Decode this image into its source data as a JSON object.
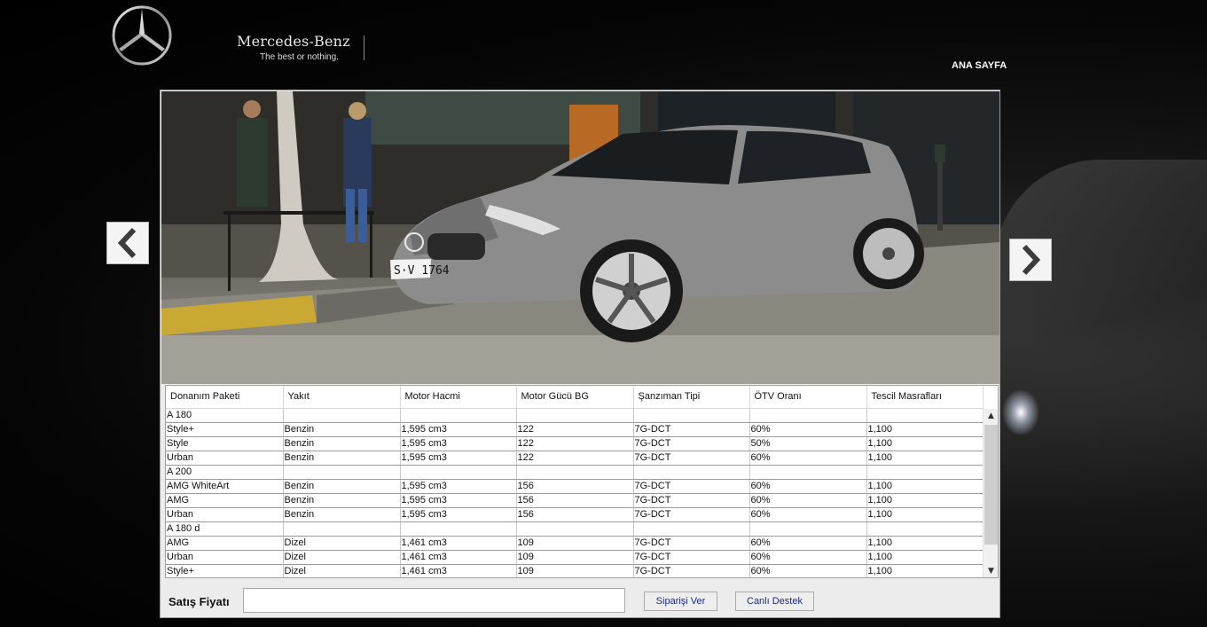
{
  "header": {
    "brand_name": "Mercedes-Benz",
    "brand_tagline": "The best or nothing.",
    "nav_home": "ANA SAYFA"
  },
  "carousel": {
    "prev_icon": "chevron-left-icon",
    "next_icon": "chevron-right-icon",
    "plate_text": "S·V 1764"
  },
  "table": {
    "columns": [
      "Donanım Paketi",
      "Yakıt",
      "Motor Hacmi",
      "Motor Gücü BG",
      "Şanzıman Tipi",
      "ÖTV Oranı",
      "Tescil Masrafları"
    ],
    "rows": [
      [
        "A 180",
        "",
        "",
        "",
        "",
        "",
        ""
      ],
      [
        "Style+",
        "Benzin",
        "1,595 cm3",
        "122",
        "7G-DCT",
        "60%",
        "1,100"
      ],
      [
        "Style",
        "Benzin",
        "1,595 cm3",
        "122",
        "7G-DCT",
        "50%",
        "1,100"
      ],
      [
        "Urban",
        "Benzin",
        "1,595 cm3",
        "122",
        "7G-DCT",
        "60%",
        "1,100"
      ],
      [
        "A 200",
        "",
        "",
        "",
        "",
        "",
        ""
      ],
      [
        "AMG WhiteArt",
        "Benzin",
        "1,595 cm3",
        "156",
        "7G-DCT",
        "60%",
        "1,100"
      ],
      [
        "AMG",
        "Benzin",
        "1,595 cm3",
        "156",
        "7G-DCT",
        "60%",
        "1,100"
      ],
      [
        "Urban",
        "Benzin",
        "1,595 cm3",
        "156",
        "7G-DCT",
        "60%",
        "1,100"
      ],
      [
        "A 180 d",
        "",
        "",
        "",
        "",
        "",
        ""
      ],
      [
        "AMG",
        "Dizel",
        "1,461 cm3",
        "109",
        "7G-DCT",
        "60%",
        "1,100"
      ],
      [
        "Urban",
        "Dizel",
        "1,461 cm3",
        "109",
        "7G-DCT",
        "60%",
        "1,100"
      ],
      [
        "Style+",
        "Dizel",
        "1,461 cm3",
        "109",
        "7G-DCT",
        "60%",
        "1,100"
      ]
    ]
  },
  "footer": {
    "price_label": "Satış Fiyatı",
    "price_value": "",
    "order_button": "Siparişi Ver",
    "support_button": "Canlı Destek"
  }
}
